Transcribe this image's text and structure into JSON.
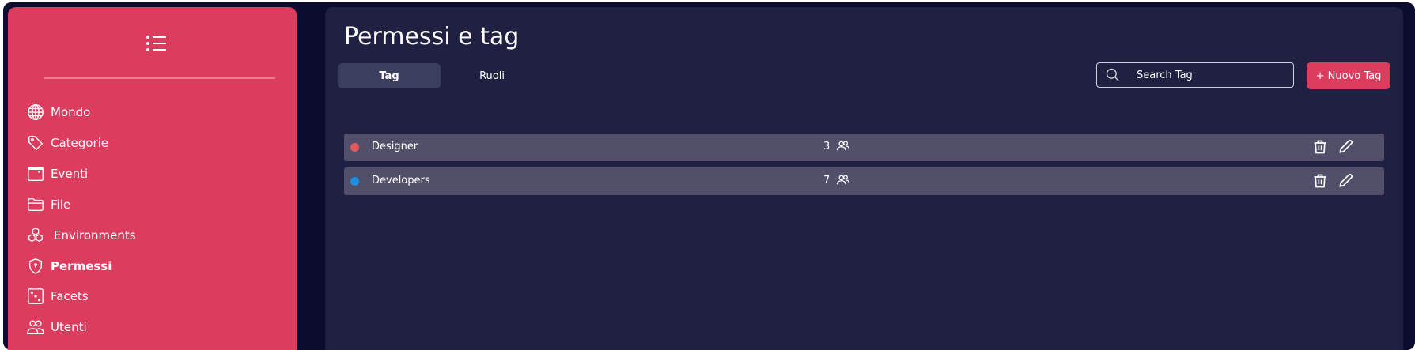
{
  "sidebar": {
    "items": [
      {
        "label": "Mondo",
        "icon": "globe-icon"
      },
      {
        "label": "Categorie",
        "icon": "tag-icon"
      },
      {
        "label": "Eventi",
        "icon": "calendar-window-icon"
      },
      {
        "label": "File",
        "icon": "folder-icon"
      },
      {
        "label": "Environments",
        "icon": "cubes-icon"
      },
      {
        "label": "Permessi",
        "icon": "shield-icon",
        "active": true
      },
      {
        "label": "Facets",
        "icon": "dice-icon"
      },
      {
        "label": "Utenti",
        "icon": "users-icon"
      }
    ]
  },
  "main": {
    "title": "Permessi e tag",
    "tabs": [
      {
        "label": "Tag",
        "active": true
      },
      {
        "label": "Ruoli"
      }
    ],
    "search": {
      "placeholder": "Search Tag",
      "value": ""
    },
    "new_button": "+ Nuovo Tag",
    "rows": [
      {
        "name": "Designer",
        "count": "3",
        "color": "#e05a5f"
      },
      {
        "name": "Developers",
        "count": "7",
        "color": "#1e8fe0"
      }
    ]
  },
  "colors": {
    "accent": "#dc3d5f",
    "panel": "#1f2042",
    "row": "#524f6b"
  }
}
